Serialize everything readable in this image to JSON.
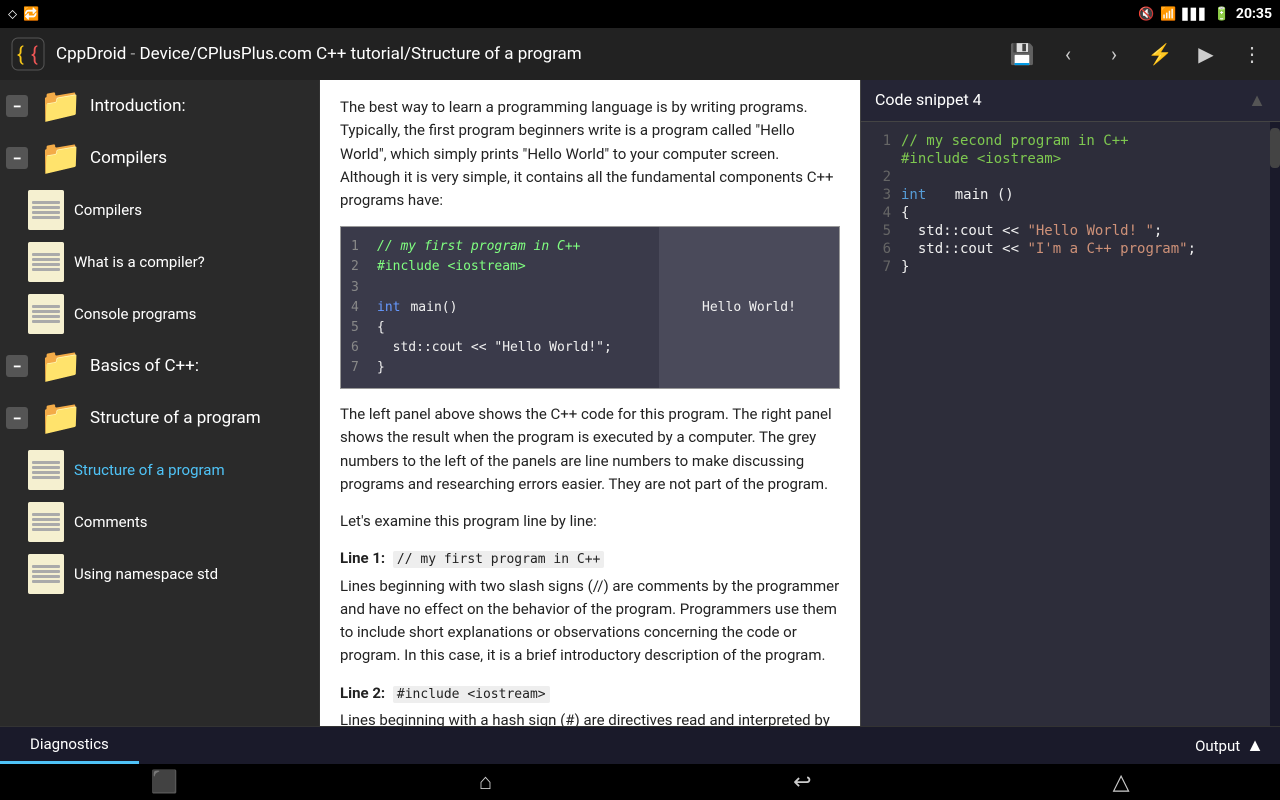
{
  "statusBar": {
    "time": "20:35",
    "icons": [
      "signal",
      "wifi",
      "battery"
    ]
  },
  "titleBar": {
    "appName": "CppDroid",
    "path": "Device/CPlusPlus.com C++ tutorial/Structure of a program",
    "buttons": [
      "save",
      "back",
      "forward",
      "lightning",
      "play",
      "menu"
    ]
  },
  "sidebar": {
    "sections": [
      {
        "id": "introduction",
        "label": "Introduction:",
        "collapsed": false,
        "items": []
      },
      {
        "id": "compilers",
        "label": "Compilers",
        "collapsed": false,
        "items": [
          {
            "id": "compilers-item",
            "label": "Compilers"
          },
          {
            "id": "what-is-compiler",
            "label": "What is a compiler?"
          },
          {
            "id": "console-programs",
            "label": "Console programs"
          }
        ]
      },
      {
        "id": "basics",
        "label": "Basics of C++:",
        "collapsed": false,
        "items": []
      },
      {
        "id": "structure",
        "label": "Structure of a program",
        "collapsed": false,
        "items": [
          {
            "id": "structure-item",
            "label": "Structure of a program",
            "active": true
          },
          {
            "id": "comments",
            "label": "Comments"
          },
          {
            "id": "using-namespace",
            "label": "Using namespace std"
          }
        ]
      }
    ]
  },
  "content": {
    "intro": "The best way to learn a programming language is by writing programs. Typically, the first program beginners write is a program called \"Hello World\", which simply prints \"Hello World\" to your computer screen. Although it is very simple, it contains all the fundamental components C++ programs have:",
    "codeLeft": [
      {
        "num": "1",
        "text": "// my first program in C++"
      },
      {
        "num": "2",
        "text": "#include <iostream>"
      },
      {
        "num": "3",
        "text": ""
      },
      {
        "num": "4",
        "text": "int main()"
      },
      {
        "num": "5",
        "text": "{"
      },
      {
        "num": "6",
        "text": "  std::cout << \"Hello World!\";"
      },
      {
        "num": "7",
        "text": "}"
      }
    ],
    "codeOutput": "Hello World!",
    "explanation": "The left panel above shows the C++ code for this program. The right panel shows the result when the program is executed by a computer. The grey numbers to the left of the panels are line numbers to make discussing programs and researching errors easier. They are not part of the program.",
    "examine": "Let's examine this program line by line:",
    "line1label": "Line 1:",
    "line1code": "// my first program in C++",
    "line1text": "Lines beginning with two slash signs (//) are comments by the programmer and have no effect on the behavior of the program. Programmers use them to include short explanations or observations concerning the code or program. In this case, it is a brief introductory description of the program.",
    "line2label": "Line 2:",
    "line2code": "#include <iostream>",
    "line2text": "Lines beginning with a hash sign (#) are directives read and interpreted by what is known as the preprocessor. They are"
  },
  "codeSnippet": {
    "title": "Code snippet 4",
    "lines": [
      {
        "num": "1",
        "text": "// my second program in C++",
        "type": "comment"
      },
      {
        "num": "",
        "text": "#include <iostream>",
        "type": "include"
      },
      {
        "num": "2",
        "text": "",
        "type": "blank"
      },
      {
        "num": "3",
        "text": "int main ()",
        "type": "mixed"
      },
      {
        "num": "4",
        "text": "{",
        "type": "normal"
      },
      {
        "num": "5",
        "text": "  std::cout << \"Hello World! \";",
        "type": "normal"
      },
      {
        "num": "6",
        "text": "  std::cout << \"I'm a C++ program\";",
        "type": "normal"
      },
      {
        "num": "7",
        "text": "}",
        "type": "normal"
      }
    ]
  },
  "diagnosticsBar": {
    "activeTab": "Diagnostics",
    "tabs": [
      "Diagnostics",
      "Output"
    ],
    "outputLabel": "Output",
    "expandIcon": "▲"
  },
  "bottomNav": {
    "buttons": [
      "recent",
      "home",
      "back",
      "up"
    ]
  }
}
